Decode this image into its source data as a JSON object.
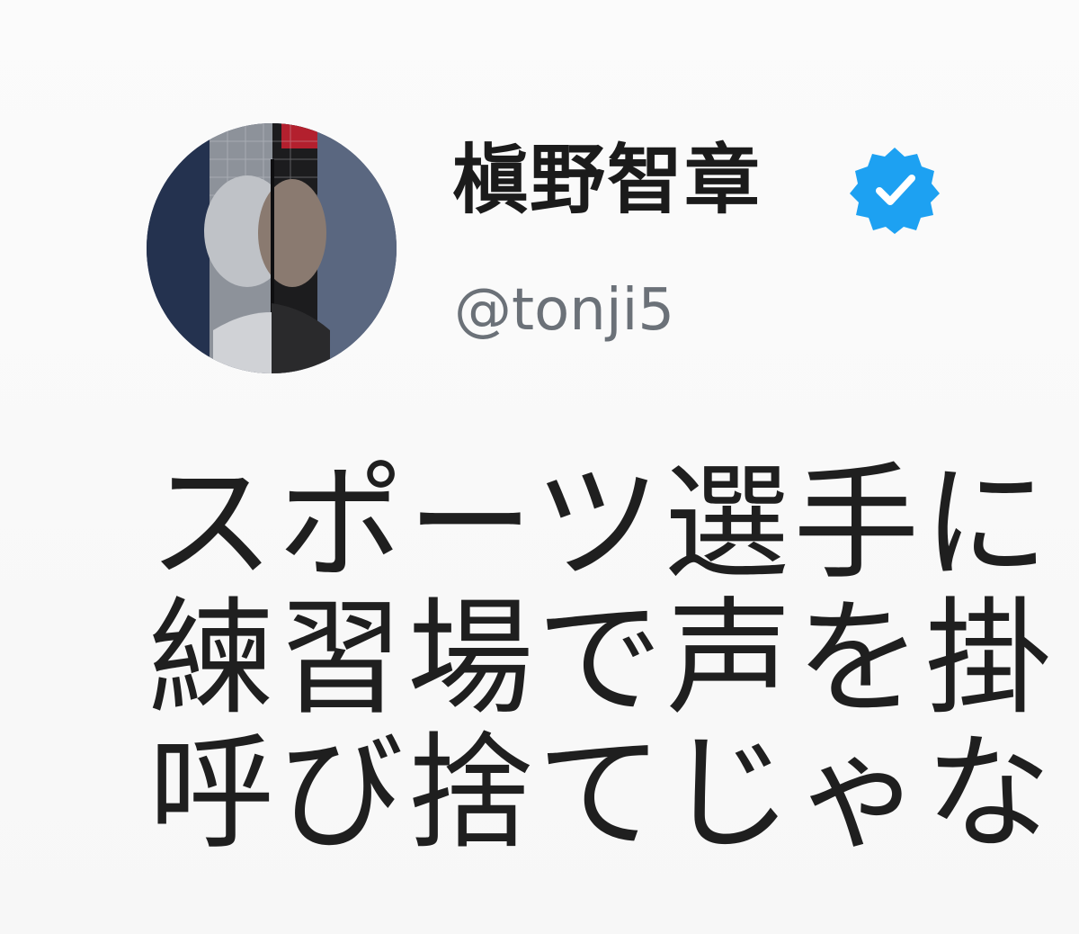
{
  "profile": {
    "display_name": "槇野智章",
    "handle": "@tonji5",
    "verified_icon": "verified-check-icon",
    "avatar_icon": "profile-photo"
  },
  "tweet": {
    "lines": [
      "スポーツ選手に",
      "練習場で声を掛",
      "呼び捨てじゃな"
    ]
  },
  "colors": {
    "verified_blue": "#1da1f2",
    "handle_gray": "#6b7178",
    "text": "#1f1f1f"
  }
}
